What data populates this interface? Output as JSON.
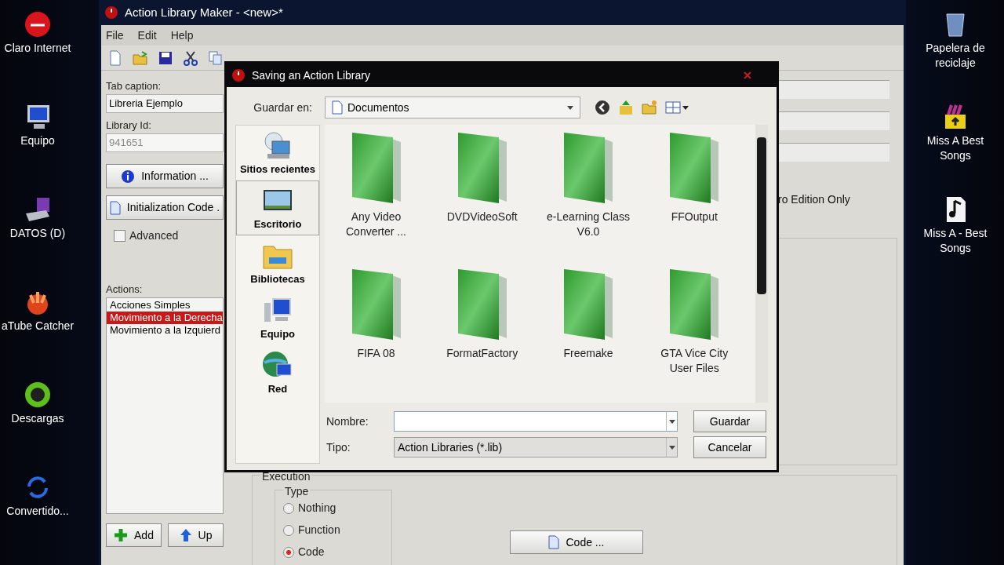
{
  "desktop": {
    "left_icons": [
      {
        "kind": "claro",
        "label": "Claro Internet"
      },
      {
        "kind": "computer",
        "label": "Equipo"
      },
      {
        "kind": "drive",
        "label": "DATOS (D)"
      },
      {
        "kind": "atube",
        "label": "aTube Catcher"
      },
      {
        "kind": "downloads",
        "label": "Descargas"
      },
      {
        "kind": "convert",
        "label": "Convertido..."
      }
    ],
    "right_icons": [
      {
        "kind": "recycle",
        "label": "Papelera de reciclaje"
      },
      {
        "kind": "archive",
        "label": "Miss A Best Songs"
      },
      {
        "kind": "mp3",
        "label": "Miss A - Best Songs"
      }
    ]
  },
  "window": {
    "title": "Action Library Maker - <new>*",
    "menu": [
      "File",
      "Edit",
      "Help"
    ],
    "toolbar": [
      {
        "kind": "new"
      },
      {
        "kind": "open"
      },
      {
        "kind": "save"
      },
      {
        "kind": "cut"
      },
      {
        "kind": "copy"
      }
    ],
    "tab_caption": {
      "label": "Tab caption:",
      "value": "Libreria Ejemplo"
    },
    "library_id": {
      "label": "Library Id:",
      "value": "941651",
      "disabled": true
    },
    "info_button": "Information ...",
    "init_button": "Initialization Code .",
    "advanced": {
      "label": "Advanced",
      "checked": false
    },
    "actions": {
      "label": "Actions:",
      "items": [
        {
          "text": "Acciones Simples",
          "selected": false
        },
        {
          "text": "Movimiento a la Derecha",
          "selected": true
        },
        {
          "text": "Movimiento a la Izquierd",
          "selected": false
        }
      ]
    },
    "add_button": "Add",
    "up_button": "Up",
    "pro_note": "ro Edition Only",
    "execution": {
      "title": "Execution",
      "type_title": "Type",
      "options": [
        {
          "label": "Nothing",
          "selected": false
        },
        {
          "label": "Function",
          "selected": false
        },
        {
          "label": "Code",
          "selected": true
        }
      ],
      "code_button": "Code ..."
    }
  },
  "dialog": {
    "title": "Saving an Action Library",
    "save_in_label": "Guardar en:",
    "location": "Documentos",
    "places": [
      {
        "kind": "recent",
        "label": "Sitios recientes",
        "selected": false
      },
      {
        "kind": "desktop",
        "label": "Escritorio",
        "selected": true
      },
      {
        "kind": "libraries",
        "label": "Bibliotecas",
        "selected": false
      },
      {
        "kind": "computer",
        "label": "Equipo",
        "selected": false
      },
      {
        "kind": "network",
        "label": "Red",
        "selected": false
      }
    ],
    "folders": [
      "Any Video Converter ...",
      "DVDVideoSoft",
      "e-Learning Class V6.0",
      "FFOutput",
      "FIFA 08",
      "FormatFactory",
      "Freemake",
      "GTA Vice City User Files"
    ],
    "name_label": "Nombre:",
    "type_label": "Tipo:",
    "type_value": "Action Libraries (*.lib)",
    "save_button": "Guardar",
    "cancel_button": "Cancelar"
  }
}
